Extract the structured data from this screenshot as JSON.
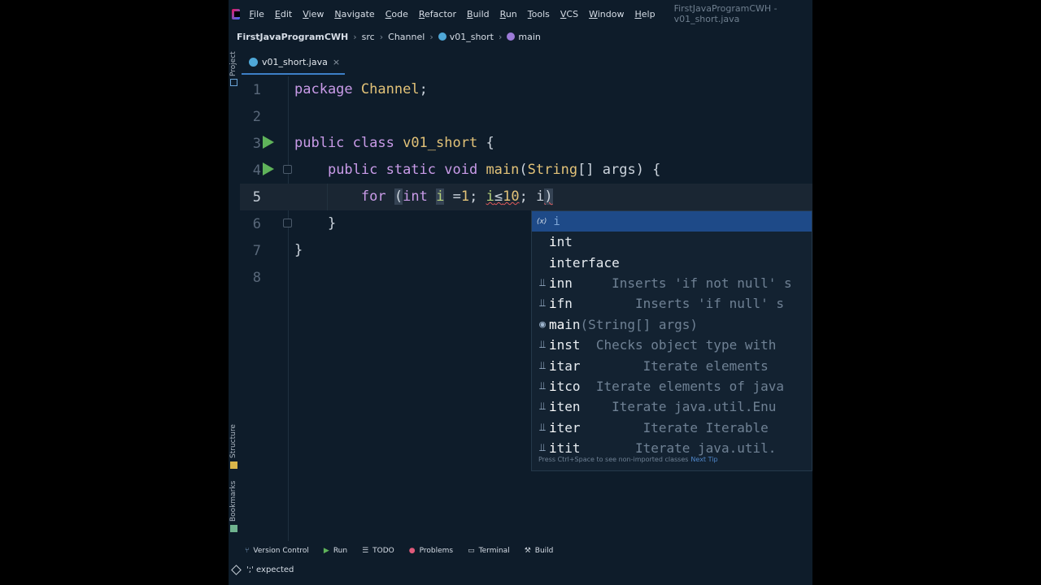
{
  "menubar": {
    "items": [
      "File",
      "Edit",
      "View",
      "Navigate",
      "Code",
      "Refactor",
      "Build",
      "Run",
      "Tools",
      "VCS",
      "Window",
      "Help"
    ],
    "window_title": "FirstJavaProgramCWH - v01_short.java"
  },
  "breadcrumb": {
    "project": "FirstJavaProgramCWH",
    "src": "src",
    "package": "Channel",
    "class": "v01_short",
    "method": "main"
  },
  "side_tabs": {
    "project": "Project",
    "structure": "Structure",
    "bookmarks": "Bookmarks"
  },
  "editor_tab": {
    "file_name": "v01_short.java",
    "close": "×"
  },
  "code": {
    "line_numbers": [
      "1",
      "2",
      "3",
      "4",
      "5",
      "6",
      "7",
      "8"
    ],
    "l1_kw": "package",
    "l1_name": "Channel",
    "l1_semi": ";",
    "l3_kw": "public class",
    "l3_name": "v01_short",
    "l3_brace": " {",
    "l4_kw": "public static void",
    "l4_fn": "main",
    "l4_rest_open": "(",
    "l4_type": "String",
    "l4_rest": "[] args) {",
    "l5_kw": "for",
    "l5_paren": "(",
    "l5_int": "int",
    "l5_i": "i",
    "l5_eq": "=",
    "l5_one": "1",
    "l5_semi": ";",
    "l5_i2": "i",
    "l5_le": "≤",
    "l5_ten": "10",
    "l5_semi2": ";",
    "l5_i3": "i",
    "l5_close": ")",
    "l6_brace": "}",
    "l7_brace": "}"
  },
  "completion": {
    "badge": "(x)",
    "typed": "i",
    "items": [
      {
        "icon": "",
        "prefix": "i",
        "rest": "nt",
        "desc": ""
      },
      {
        "icon": "",
        "prefix": "i",
        "rest": "nterface",
        "desc": ""
      },
      {
        "icon": "⫫",
        "prefix": "i",
        "rest": "nn",
        "desc": "     Inserts 'if not null' s"
      },
      {
        "icon": "⫫",
        "prefix": "i",
        "rest": "fn",
        "desc": "        Inserts 'if null' s"
      },
      {
        "icon": "◉",
        "prefix": "ma",
        "rest": "in",
        "desc": "(String[] args)"
      },
      {
        "icon": "⫫",
        "prefix": "i",
        "rest": "nst",
        "desc": "  Checks object type with"
      },
      {
        "icon": "⫫",
        "prefix": "i",
        "rest": "tar",
        "desc": "        Iterate elements"
      },
      {
        "icon": "⫫",
        "prefix": "i",
        "rest": "tco",
        "desc": "  Iterate elements of java"
      },
      {
        "icon": "⫫",
        "prefix": "i",
        "rest": "ten",
        "desc": "    Iterate java.util.Enu"
      },
      {
        "icon": "⫫",
        "prefix": "i",
        "rest": "ter",
        "desc": "        Iterate Iterable"
      },
      {
        "icon": "⫫",
        "prefix": "i",
        "rest": "tit",
        "desc": "       Iterate java.util."
      }
    ],
    "footer": "Press Ctrl+Space to see non-imported classes",
    "footer_tip": "Next Tip"
  },
  "toolbar": {
    "version_control": "Version Control",
    "run": "Run",
    "todo": "TODO",
    "problems": "Problems",
    "terminal": "Terminal",
    "build": "Build"
  },
  "status": {
    "message": "';' expected"
  },
  "colors": {
    "background": "#0e1c2a",
    "keyword": "#c99be8",
    "identifier": "#e2c278",
    "variable": "#b7d37a",
    "selection_header": "#1e4a88",
    "run_icon": "#5fb35a"
  }
}
